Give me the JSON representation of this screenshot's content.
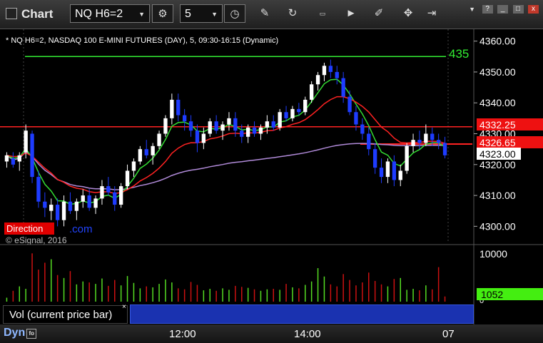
{
  "toolbar": {
    "title": "Chart",
    "symbol": "NQ H6=2",
    "interval": "5",
    "icons": [
      "chart-icon",
      "link-icon",
      "clock-icon",
      "pencil-icon",
      "refresh-icon",
      "get-data-icon",
      "play-icon",
      "eraser-icon",
      "settings-icon",
      "share-icon"
    ],
    "window_buttons": [
      "?",
      "_",
      "□",
      "x"
    ]
  },
  "chart_header": "* NQ H6=2, NASDAQ 100 E-MINI FUTURES (DAY), 5, 09:30-16:15 (Dynamic)",
  "watermark": {
    "brand_left": "Direction",
    "brand_right": ".com",
    "copyright": "© eSignal, 2016"
  },
  "price_axis": {
    "ticks": [
      "4360.00",
      "4350.00",
      "4340.00",
      "4330.00",
      "4320.00",
      "4310.00",
      "4300.00"
    ],
    "tags": {
      "red": "4332.25",
      "red2": "4326.65",
      "last": "4323.00"
    },
    "line_label": "435"
  },
  "volume_axis": {
    "ticks": [
      "10000",
      "0"
    ],
    "last": "1052"
  },
  "vol_panel_label": "Vol (current price bar)",
  "time_axis": [
    "12:00",
    "14:00",
    "07"
  ],
  "status": {
    "mode": "Dyn"
  },
  "colors": {
    "up": "#ffffff",
    "down": "#1e3cff",
    "ma_fast": "#33dd33",
    "ma_slow": "#ff2222",
    "vwap": "#b08ad8"
  },
  "chart_data": {
    "type": "candlestick",
    "title": "* NQ H6=2, NASDAQ 100 E-MINI FUTURES (DAY), 5, 09:30-16:15 (Dynamic)",
    "ylim": [
      4295,
      4362
    ],
    "volume_ylim": [
      0,
      11000
    ],
    "horizontal_lines": [
      {
        "value": 4355,
        "color": "#33ee33"
      },
      {
        "value": 4332.25,
        "color": "#ff2222"
      },
      {
        "value": 4326.65,
        "color": "#ff2222"
      }
    ],
    "candles": [
      [
        4321,
        4324,
        4319,
        4323
      ],
      [
        4322,
        4324,
        4319,
        4320
      ],
      [
        4321,
        4324,
        4318,
        4323
      ],
      [
        4324,
        4333,
        4322,
        4331
      ],
      [
        4330,
        4331,
        4314,
        4316
      ],
      [
        4316,
        4318,
        4306,
        4308
      ],
      [
        4308,
        4311,
        4303,
        4306
      ],
      [
        4305,
        4309,
        4302,
        4307
      ],
      [
        4307,
        4309,
        4300,
        4302
      ],
      [
        4302,
        4310,
        4300,
        4308
      ],
      [
        4308,
        4311,
        4304,
        4305
      ],
      [
        4305,
        4309,
        4302,
        4308
      ],
      [
        4308,
        4312,
        4306,
        4310
      ],
      [
        4310,
        4312,
        4305,
        4306
      ],
      [
        4306,
        4310,
        4304,
        4309
      ],
      [
        4309,
        4315,
        4307,
        4313
      ],
      [
        4313,
        4316,
        4310,
        4311
      ],
      [
        4311,
        4313,
        4305,
        4307
      ],
      [
        4307,
        4314,
        4306,
        4313
      ],
      [
        4313,
        4320,
        4312,
        4318
      ],
      [
        4318,
        4322,
        4316,
        4321
      ],
      [
        4321,
        4326,
        4320,
        4325
      ],
      [
        4325,
        4328,
        4322,
        4323
      ],
      [
        4323,
        4327,
        4320,
        4326
      ],
      [
        4326,
        4331,
        4325,
        4330
      ],
      [
        4330,
        4336,
        4329,
        4335
      ],
      [
        4335,
        4343,
        4333,
        4341
      ],
      [
        4341,
        4343,
        4334,
        4336
      ],
      [
        4336,
        4338,
        4331,
        4334
      ],
      [
        4334,
        4336,
        4329,
        4331
      ],
      [
        4331,
        4333,
        4324,
        4327
      ],
      [
        4327,
        4332,
        4325,
        4330
      ],
      [
        4330,
        4335,
        4329,
        4334
      ],
      [
        4334,
        4336,
        4330,
        4331
      ],
      [
        4331,
        4334,
        4328,
        4333
      ],
      [
        4333,
        4337,
        4331,
        4335
      ],
      [
        4335,
        4337,
        4329,
        4331
      ],
      [
        4331,
        4333,
        4327,
        4329
      ],
      [
        4329,
        4333,
        4327,
        4332
      ],
      [
        4332,
        4334,
        4329,
        4330
      ],
      [
        4330,
        4333,
        4328,
        4332
      ],
      [
        4332,
        4336,
        4330,
        4334
      ],
      [
        4334,
        4336,
        4331,
        4332
      ],
      [
        4332,
        4338,
        4331,
        4337
      ],
      [
        4337,
        4339,
        4334,
        4335
      ],
      [
        4335,
        4339,
        4334,
        4338
      ],
      [
        4338,
        4340,
        4336,
        4337
      ],
      [
        4337,
        4342,
        4336,
        4341
      ],
      [
        4341,
        4347,
        4340,
        4346
      ],
      [
        4346,
        4350,
        4344,
        4349
      ],
      [
        4349,
        4353,
        4347,
        4352
      ],
      [
        4352,
        4354,
        4348,
        4350
      ],
      [
        4350,
        4352,
        4346,
        4348
      ],
      [
        4348,
        4350,
        4340,
        4342
      ],
      [
        4342,
        4344,
        4336,
        4337
      ],
      [
        4337,
        4339,
        4331,
        4333
      ],
      [
        4333,
        4335,
        4328,
        4330
      ],
      [
        4330,
        4332,
        4323,
        4325
      ],
      [
        4325,
        4327,
        4317,
        4319
      ],
      [
        4319,
        4322,
        4314,
        4316
      ],
      [
        4316,
        4322,
        4314,
        4321
      ],
      [
        4321,
        4323,
        4313,
        4315
      ],
      [
        4315,
        4320,
        4313,
        4318
      ],
      [
        4318,
        4327,
        4317,
        4326
      ],
      [
        4326,
        4330,
        4324,
        4328
      ],
      [
        4328,
        4331,
        4325,
        4327
      ],
      [
        4327,
        4333,
        4326,
        4330
      ],
      [
        4330,
        4332,
        4326,
        4328
      ],
      [
        4328,
        4330,
        4325,
        4327
      ],
      [
        4327,
        4329,
        4322,
        4323
      ]
    ],
    "volume": [
      800,
      2200,
      3100,
      2600,
      9800,
      6500,
      7900,
      8600,
      5400,
      4800,
      6200,
      3500,
      4100,
      3900,
      3600,
      4700,
      3200,
      4400,
      3300,
      5200,
      3800,
      2700,
      3100,
      2900,
      3600,
      4500,
      3900,
      2700,
      2500,
      4000,
      3400,
      2300,
      2600,
      2200,
      2700,
      2400,
      3200,
      3000,
      2800,
      2500,
      2200,
      2500,
      2600,
      2400,
      3600,
      2900,
      2700,
      3400,
      4100,
      6800,
      5100,
      3500,
      3100,
      5600,
      4400,
      3300,
      3900,
      5900,
      4200,
      3500,
      3100,
      4600,
      4800,
      2400,
      2600,
      2300,
      3300,
      2500,
      7000,
      1052
    ]
  }
}
